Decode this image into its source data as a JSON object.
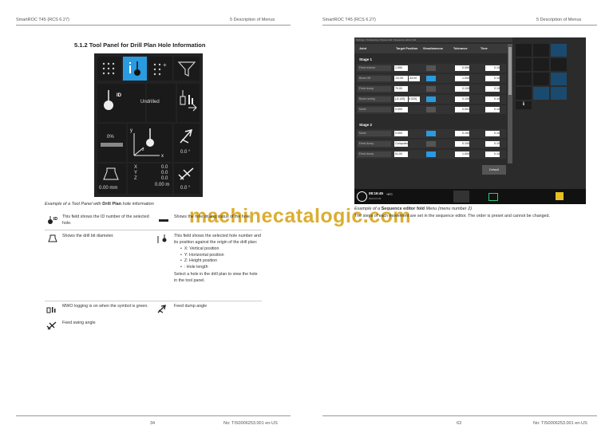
{
  "left": {
    "header_left": "SmartROC T45 (RCS 6.27)",
    "header_right": "5 Description of Menus",
    "section_title": "5.1.2 Tool Panel for Drill Plan Hole Information",
    "panel": {
      "undrilled": "Undrilled",
      "percent": "0%",
      "dump_angle": "0.0 °",
      "swing_angle": "0.0 °",
      "xyz_labels": [
        "X",
        "Y",
        "Z"
      ],
      "xyz_values": [
        "0.0",
        "0.0",
        "0.0"
      ],
      "hole_length": "0.00 m",
      "bit_diameter": "0.00 mm",
      "id_label": "ID"
    },
    "caption_prefix": "Example of a Tool Panel with ",
    "caption_bold": "Drill Plan",
    "caption_suffix": " hole information",
    "table": {
      "id_text": "This field shows the ID number of the selected hole.",
      "status_text": "Shows the hole drilling status of the hole.",
      "bit_text": "Shows the drill bit diameter.",
      "pos_text": "This field shows the selected hole number and its position against the origin of the drill plan:",
      "pos_items": [
        "X: Vertical position",
        "Y: Horizontal position",
        "Z: Height position",
        ": Hole length"
      ],
      "pos_select": "Select a hole in the drill plan to view the hole in the tool panel.",
      "mwo_text": "MWO logging is on when the symbol is green.",
      "dump_text": "Feed dump angle",
      "swing_text": "Feed swing angle"
    },
    "watermark": "machinecatalogic.com",
    "footer_page": "34",
    "footer_doc": "No: TIS0006253.001 en-US"
  },
  "right": {
    "header_left": "SmartROC T45 (RCS 6.27)",
    "header_right": "5 Description of Menus",
    "screen": {
      "breadcrumb": "Settings / Positioning / Rotate fold / Sequence editor fold",
      "columns": [
        "Joint",
        "Target Position",
        "Simultaneous",
        "Tolerance",
        "Time"
      ],
      "stage1": "Stage 1",
      "stage2": "Stage 2",
      "rows": [
        {
          "joint": "Feed extend",
          "target": "1.050",
          "tol": "0.050",
          "time": "0.10"
        },
        {
          "joint": "Boom lift",
          "target": "-31.00",
          "target2": "-33.00",
          "tol": "1.000",
          "time": "0.10"
        },
        {
          "joint": "Feed dump",
          "target": "70.00",
          "tol": "0.100",
          "time": "0.10"
        },
        {
          "joint": "Boom swing",
          "target": "[-5.120]",
          "target2": "0.020]",
          "tol": "0.100",
          "time": "0.10"
        },
        {
          "joint": "None",
          "target": "0.000",
          "tol": "0.001",
          "time": "0.10"
        },
        {
          "joint": "None",
          "target": "0.000",
          "tol": "0.100",
          "time": "0.10"
        },
        {
          "joint": "Feed dump",
          "target": "Computed",
          "tol": "0.100",
          "time": "0.10"
        },
        {
          "joint": "Feed dump",
          "target": "51.00",
          "tol": "1.000",
          "time": "0.10"
        }
      ],
      "default_btn": "Default",
      "clock_time": "08:16:45",
      "clock_date": "2024-04-09",
      "temp": "+5°C"
    },
    "caption_prefix": "Example of a ",
    "caption_bold": "Sequence editor fold",
    "caption_suffix": " Menu (menu number 2)",
    "body": "The steps of each movement are set in the sequence editor. The order is preset and cannot be changed.",
    "footer_page": "63",
    "footer_doc": "No: TIS0006253.001 en-US"
  },
  "colors": {
    "accent": "#2a9be0",
    "watermark": "#d9a820",
    "panel_bg": "#222222"
  }
}
